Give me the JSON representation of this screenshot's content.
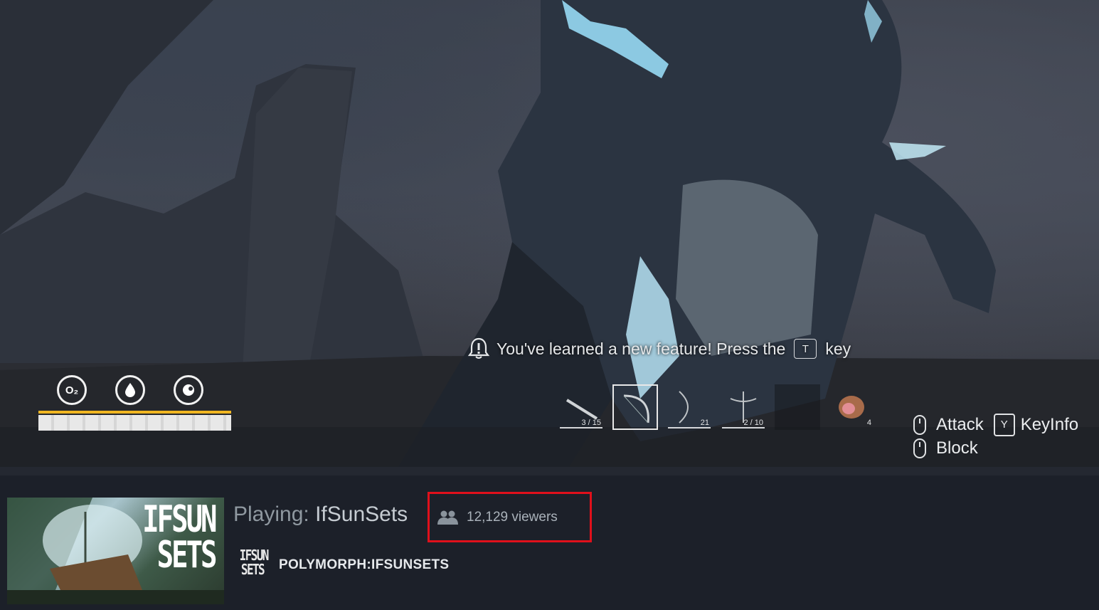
{
  "game_hud": {
    "notice": {
      "text_before": "You've learned a new feature!  Press the",
      "key": "T",
      "text_after": "key"
    },
    "stat_icons": [
      {
        "name": "oxygen-icon",
        "glyph": "O₂"
      },
      {
        "name": "water-drop-icon",
        "glyph": "💧"
      },
      {
        "name": "food-icon",
        "glyph": "◔"
      }
    ],
    "stamina_fill": 1.0,
    "hotbar": [
      {
        "name": "hotbar-slot-rifle",
        "count": "3 / 15",
        "selected": false
      },
      {
        "name": "hotbar-slot-bow",
        "count": "",
        "selected": true
      },
      {
        "name": "hotbar-slot-longbow",
        "count": "21",
        "selected": false
      },
      {
        "name": "hotbar-slot-crossbow",
        "count": "2 / 10",
        "selected": false
      },
      {
        "name": "hotbar-slot-empty",
        "count": "",
        "selected": false
      },
      {
        "name": "hotbar-slot-meat",
        "count": "4",
        "selected": false
      }
    ],
    "controls": {
      "attack_label": "Attack",
      "keyinfo_key": "Y",
      "keyinfo_label": "KeyInfo",
      "block_label": "Block"
    }
  },
  "stream_info": {
    "playing_label": "Playing:",
    "game_title": "IfSunSets",
    "viewers": "12,129 viewers",
    "thumbnail_logo_line1": "IFSUN",
    "thumbnail_logo_line2": "SETS",
    "streamer_logo_line1": "IFSUN",
    "streamer_logo_line2": "SETS",
    "streamer_name": "POLYMORPH:IFSUNSETS"
  },
  "colors": {
    "highlight_box": "#e0101b",
    "stamina_gold": "#f0b622",
    "background": "#1c2029"
  }
}
